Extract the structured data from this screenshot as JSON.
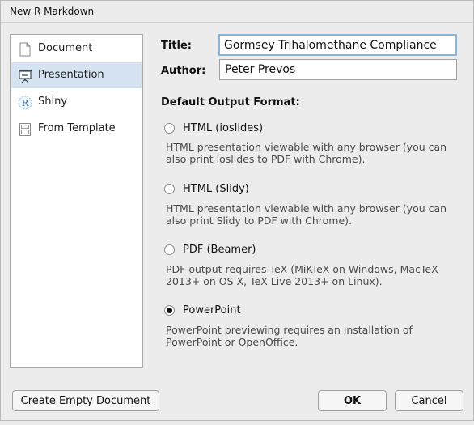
{
  "window": {
    "title": "New R Markdown"
  },
  "sidebar": {
    "items": [
      {
        "label": "Document",
        "icon": "document-icon",
        "selected": false
      },
      {
        "label": "Presentation",
        "icon": "presentation-icon",
        "selected": true
      },
      {
        "label": "Shiny",
        "icon": "shiny-r-icon",
        "selected": false
      },
      {
        "label": "From Template",
        "icon": "template-icon",
        "selected": false
      }
    ]
  },
  "form": {
    "title_label": "Title:",
    "title_value": "Gormsey Trihalomethane Compliance",
    "author_label": "Author:",
    "author_value": "Peter Prevos",
    "format_heading": "Default Output Format:"
  },
  "formats": [
    {
      "label": "HTML (ioslides)",
      "description": "HTML presentation viewable with any browser (you can also print ioslides to PDF with Chrome).",
      "checked": false
    },
    {
      "label": "HTML (Slidy)",
      "description": "HTML presentation viewable with any browser (you can also print Slidy to PDF with Chrome).",
      "checked": false
    },
    {
      "label": "PDF (Beamer)",
      "description": "PDF output requires TeX (MiKTeX on Windows, MacTeX 2013+ on OS X, TeX Live 2013+ on Linux).",
      "checked": false
    },
    {
      "label": "PowerPoint",
      "description": "PowerPoint previewing requires an installation of PowerPoint or OpenOffice.",
      "checked": true
    }
  ],
  "buttons": {
    "create_empty": "Create Empty Document",
    "ok": "OK",
    "cancel": "Cancel"
  },
  "colors": {
    "selection": "#d6e4f1",
    "focus_border": "#8ab4d8",
    "background": "#ececec"
  }
}
